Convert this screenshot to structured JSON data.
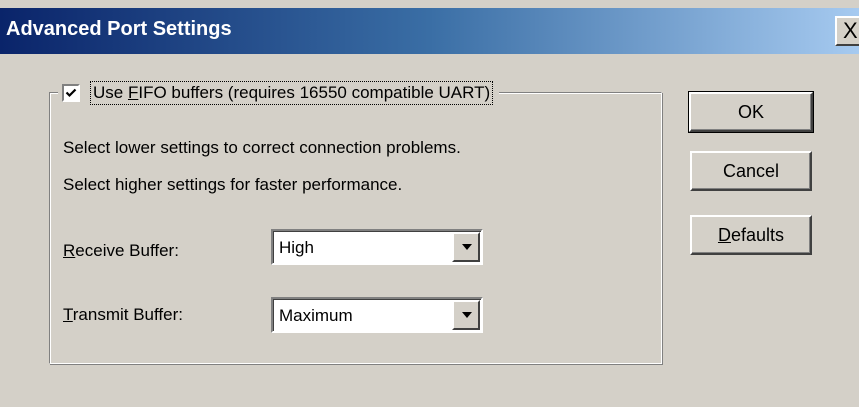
{
  "window": {
    "title": "Advanced Port Settings",
    "close_glyph": "X"
  },
  "fifo": {
    "checked": true,
    "label_prefix": "Use ",
    "label_mnemonic": "F",
    "label_rest": "IFO buffers (requires 16550 compatible UART)"
  },
  "info": {
    "line1": "Select lower settings to correct connection problems.",
    "line2": "Select higher settings for faster performance."
  },
  "receive": {
    "label_mnemonic": "R",
    "label_rest": "eceive Buffer:",
    "value": "High"
  },
  "transmit": {
    "label_mnemonic": "T",
    "label_rest": "ransmit Buffer:",
    "value": "Maximum"
  },
  "buttons": {
    "ok": "OK",
    "cancel": "Cancel",
    "defaults_mnemonic": "D",
    "defaults_rest": "efaults"
  },
  "colors": {
    "face": "#d4d0c8",
    "title_start": "#0a246a",
    "title_end": "#a6caf0"
  },
  "icons": {
    "checkbox": "checkmark-icon",
    "dropdown": "dropdown-arrow-icon",
    "close": "close-icon"
  }
}
